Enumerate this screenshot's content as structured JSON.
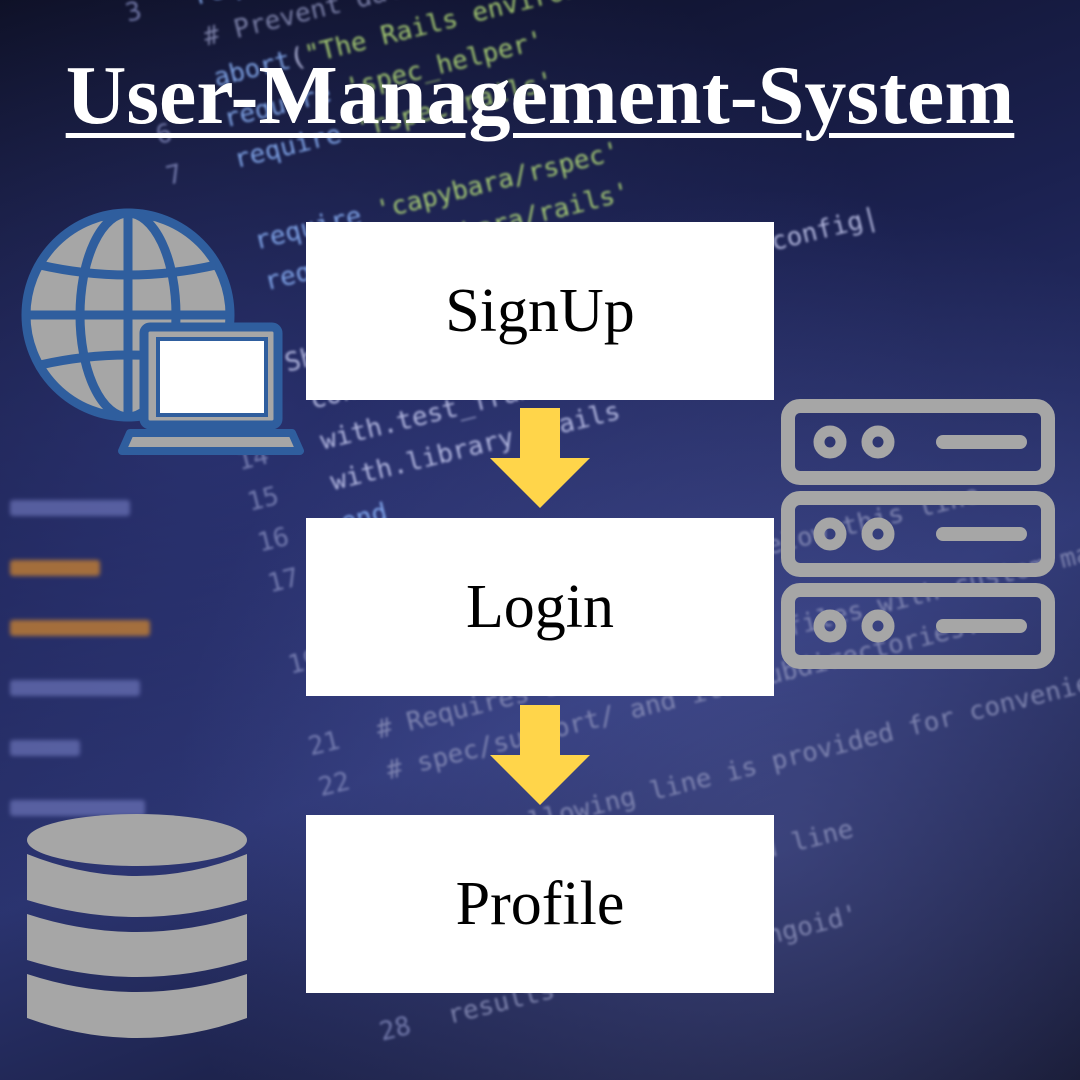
{
  "title": "User-Management-System",
  "steps": [
    {
      "label": "SignUp"
    },
    {
      "label": "Login"
    },
    {
      "label": "Profile"
    }
  ],
  "icons": {
    "left_top": "globe-laptop-icon",
    "right": "server-icon",
    "left_bottom": "database-icon"
  },
  "colors": {
    "arrow": "#FFD54A",
    "icon_blue": "#2F5E9E",
    "icon_gray": "#A6A6A6",
    "box": "#FFFFFF",
    "title": "#FFFFFF"
  }
}
